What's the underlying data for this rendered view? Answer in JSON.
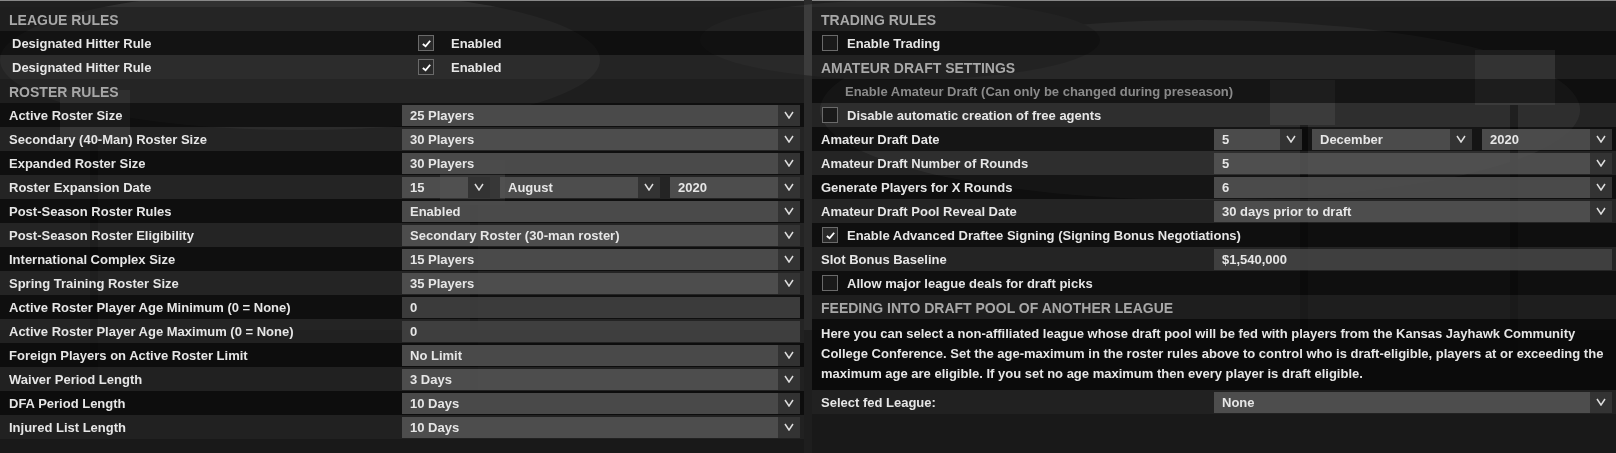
{
  "panels": [
    {
      "sections": [
        {
          "title": "LEAGUE RULES",
          "rows": [
            {
              "kind": "toggle",
              "label": "Designated Hitter Rule",
              "checked": true,
              "value": "Enabled"
            },
            {
              "kind": "toggle",
              "label": "Designated Hitter Rule",
              "checked": true,
              "value": "Enabled"
            }
          ]
        },
        {
          "title": "ROSTER RULES",
          "rows": [
            {
              "kind": "select",
              "label": "Active Roster Size",
              "value": "25 Players"
            },
            {
              "kind": "select",
              "label": "Secondary (40-Man) Roster Size",
              "value": "30 Players"
            },
            {
              "kind": "select",
              "label": "Expanded Roster Size",
              "value": "30 Players"
            },
            {
              "kind": "date",
              "label": "Roster Expansion Date",
              "parts": [
                "15",
                "August",
                "2020"
              ]
            },
            {
              "kind": "select",
              "label": "Post-Season Roster Rules",
              "value": "Enabled"
            },
            {
              "kind": "select",
              "label": "Post-Season Roster Eligibility",
              "value": "Secondary Roster (30-man roster)"
            },
            {
              "kind": "select",
              "label": "International Complex Size",
              "value": "15 Players"
            },
            {
              "kind": "select",
              "label": "Spring Training Roster Size",
              "value": "35 Players"
            },
            {
              "kind": "text",
              "label": "Active Roster Player Age Minimum (0 = None)",
              "value": "0"
            },
            {
              "kind": "text",
              "label": "Active Roster Player Age Maximum (0 = None)",
              "value": "0"
            },
            {
              "kind": "select",
              "label": "Foreign Players on Active Roster Limit",
              "value": "No Limit"
            },
            {
              "kind": "select",
              "label": "Waiver Period Length",
              "value": "3 Days"
            },
            {
              "kind": "select",
              "label": "DFA Period Length",
              "value": "10 Days"
            },
            {
              "kind": "select",
              "label": "Injured List Length",
              "value": "10 Days"
            }
          ]
        }
      ]
    },
    {
      "sections": [
        {
          "title": "TRADING RULES",
          "rows": [
            {
              "kind": "checkbox",
              "label": "Enable Trading",
              "checked": false
            }
          ]
        },
        {
          "title": "AMATEUR DRAFT SETTINGS",
          "rows": [
            {
              "kind": "note",
              "label": "Enable Amateur Draft (Can only be changed during preseason)",
              "disabled": true
            },
            {
              "kind": "checkbox",
              "label": "Disable automatic creation of free agents",
              "checked": false
            },
            {
              "kind": "date",
              "label": "Amateur Draft Date",
              "parts": [
                "5",
                "December",
                "2020"
              ]
            },
            {
              "kind": "select",
              "label": "Amateur Draft Number of Rounds",
              "value": "5"
            },
            {
              "kind": "select",
              "label": "Generate Players for X Rounds",
              "value": "6"
            },
            {
              "kind": "select",
              "label": "Amateur Draft Pool Reveal Date",
              "value": "30 days prior to draft"
            },
            {
              "kind": "checkbox",
              "label": "Enable Advanced Draftee Signing (Signing Bonus Negotiations)",
              "checked": true
            },
            {
              "kind": "text",
              "label": "Slot Bonus Baseline",
              "value": "$1,540,000"
            },
            {
              "kind": "checkbox",
              "label": "Allow major league deals for draft picks",
              "checked": false
            }
          ]
        },
        {
          "title": "FEEDING INTO DRAFT POOL OF ANOTHER LEAGUE",
          "rows": [
            {
              "kind": "paragraph",
              "text": "Here you can select a non-affiliated league whose draft pool will be fed with players from the Kansas Jayhawk Community College Conference. Set the age-maximum in the roster rules above to control who is draft-eligible, players at or exceeding the maximum age are eligible. If you set no age maximum then every player is draft eligible."
            },
            {
              "kind": "select",
              "label": "Select fed League:",
              "value": "None"
            }
          ]
        }
      ]
    }
  ]
}
